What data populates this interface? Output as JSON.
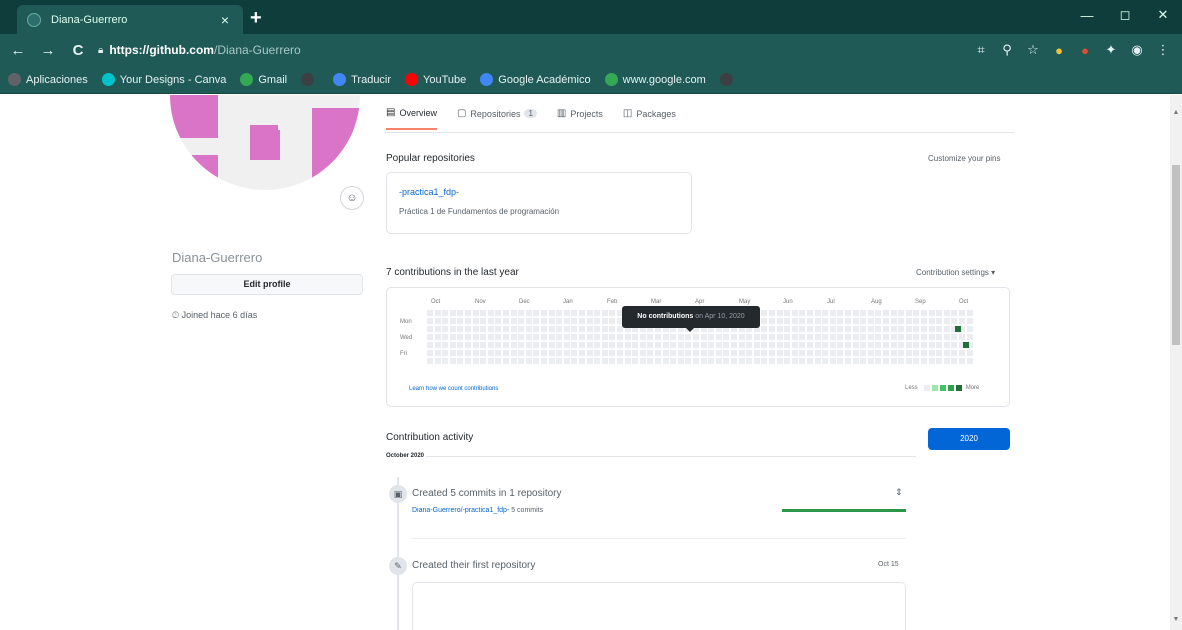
{
  "browser": {
    "tab_title": "Diana-Guerrero",
    "tab_close": "×",
    "new_tab": "+",
    "window": {
      "minimize": "—",
      "maximize": "◻",
      "close": "✕"
    },
    "nav": {
      "back": "←",
      "forward": "→",
      "reload": "C"
    },
    "url_host": "https://github.com",
    "url_path": "/Diana-Guerrero",
    "bookmarks": [
      {
        "label": "Aplicaciones",
        "icon": "apps-icon",
        "color": "#5f6368"
      },
      {
        "label": "Your Designs - Canva",
        "icon": "canva-icon",
        "color": "#00c4cc"
      },
      {
        "label": "Gmail",
        "icon": "gmail-icon",
        "color": "#34a853"
      },
      {
        "label": "",
        "icon": "globe-icon",
        "color": "#3c4043"
      },
      {
        "label": "Traducir",
        "icon": "translate-icon",
        "color": "#4285f4"
      },
      {
        "label": "YouTube",
        "icon": "youtube-icon",
        "color": "#ff0000"
      },
      {
        "label": "Google Académico",
        "icon": "scholar-icon",
        "color": "#4285f4"
      },
      {
        "label": "www.google.com",
        "icon": "google-icon",
        "color": "#34a853"
      },
      {
        "label": "",
        "icon": "globe-icon",
        "color": "#3c4043"
      }
    ]
  },
  "profile": {
    "username": "Diana-Guerrero",
    "edit_profile": "Edit profile",
    "joined": "Joined hace 6 días",
    "status_icon": "☺"
  },
  "tabs": [
    {
      "label": "Overview",
      "icon": "book-icon",
      "active": true
    },
    {
      "label": "Repositories",
      "icon": "repo-icon",
      "count": "1"
    },
    {
      "label": "Projects",
      "icon": "project-icon"
    },
    {
      "label": "Packages",
      "icon": "package-icon"
    }
  ],
  "popular": {
    "title": "Popular repositories",
    "customize": "Customize your pins",
    "repo_name": "-practica1_fdp-",
    "repo_desc": "Práctica 1 de Fundamentos de programación"
  },
  "contributions": {
    "title": "7 contributions in the last year",
    "settings": "Contribution settings ▾",
    "months": [
      "Oct",
      "Nov",
      "Dec",
      "Jan",
      "Feb",
      "Mar",
      "Apr",
      "May",
      "Jun",
      "Jul",
      "Aug",
      "Sep",
      "Oct"
    ],
    "days": [
      "Mon",
      "Wed",
      "Fri"
    ],
    "learn": "Learn how we count contributions",
    "less": "Less",
    "more": "More",
    "tooltip_bold": "No contributions",
    "tooltip_date": "on Apr 10, 2020",
    "legend_colors": [
      "#ebedf0",
      "#9be9a8",
      "#40c463",
      "#30a14e",
      "#216e39"
    ],
    "active_color": "#216e39"
  },
  "activity": {
    "title": "Contribution activity",
    "year_button": "2020",
    "month": "October 2020",
    "item1_title": "Created 5 commits in 1 repository",
    "item1_repo": "Diana-Guerrero/-practica1_fdp-",
    "item1_count": "5 commits",
    "collapse": "⇕",
    "item2_title": "Created their first repository",
    "item2_date": "Oct 15"
  }
}
